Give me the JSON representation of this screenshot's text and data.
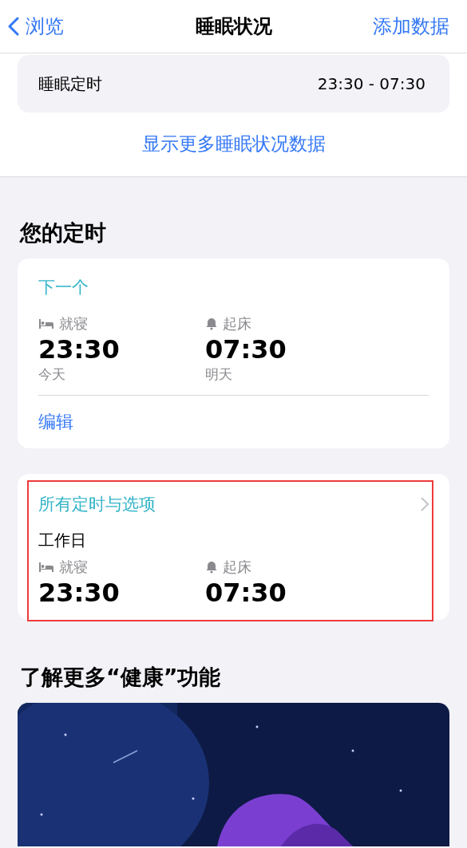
{
  "nav": {
    "back": "浏览",
    "title": "睡眠状况",
    "action": "添加数据"
  },
  "summary": {
    "label": "睡眠定时",
    "value": "23:30 - 07:30",
    "link": "显示更多睡眠状况数据"
  },
  "schedule_heading": "您的定时",
  "next_card": {
    "title": "下一个",
    "items": [
      {
        "kind": "bed",
        "label": "就寝",
        "time": "23:30",
        "day": "今天"
      },
      {
        "kind": "wake",
        "label": "起床",
        "time": "07:30",
        "day": "明天"
      }
    ],
    "edit": "编辑"
  },
  "all_card": {
    "title": "所有定时与选项",
    "subtitle": "工作日",
    "highlighted": true,
    "items": [
      {
        "kind": "bed",
        "label": "就寝",
        "time": "23:30"
      },
      {
        "kind": "wake",
        "label": "起床",
        "time": "07:30"
      }
    ]
  },
  "learn_heading": "了解更多“健康”功能"
}
